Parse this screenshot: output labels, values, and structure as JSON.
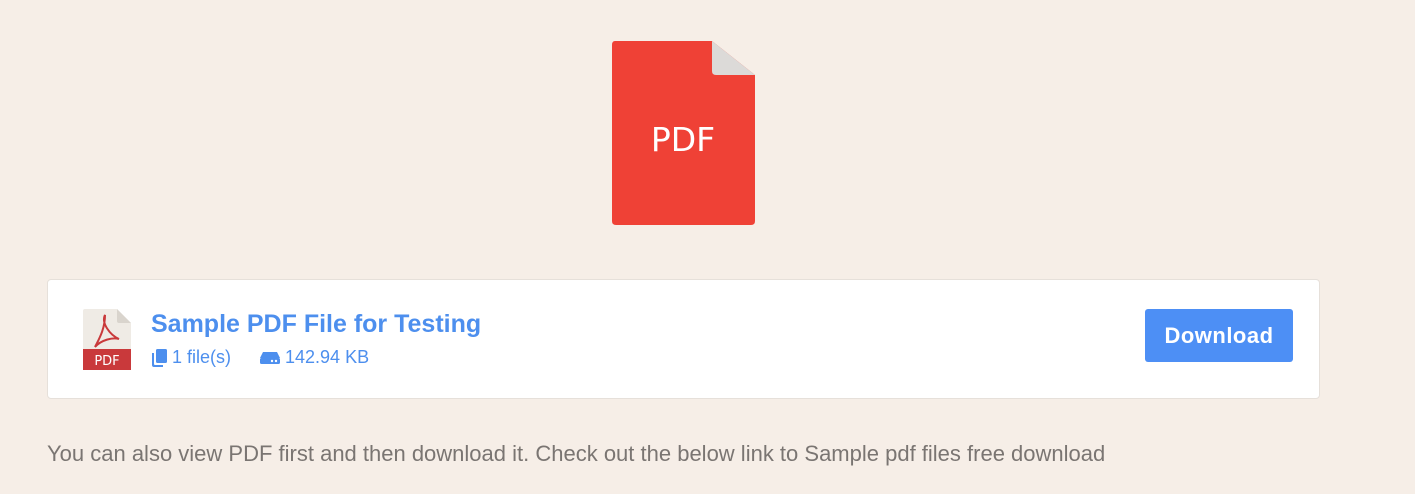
{
  "hero": {
    "icon_text": "PDF",
    "icon_color": "#ef4136"
  },
  "file_card": {
    "badge_text": "PDF",
    "title": "Sample PDF File for Testing",
    "file_count": "1 file(s)",
    "file_size": "142.94 KB",
    "download_label": "Download",
    "accent_color": "#4d8fee"
  },
  "description": "You can also view PDF first and then download it. Check out the below link to Sample pdf files free download"
}
